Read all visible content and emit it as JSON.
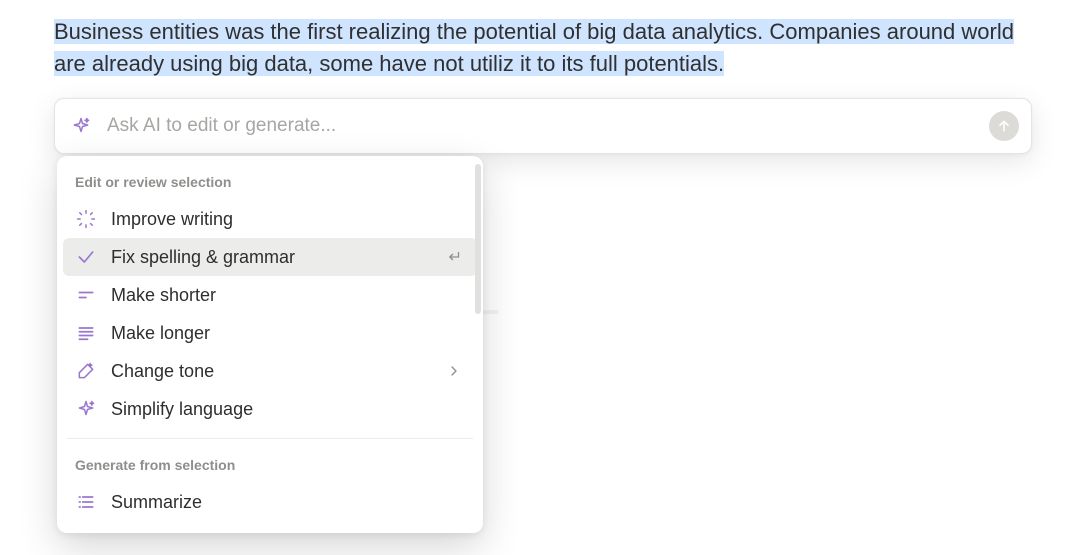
{
  "selected_text": "Business entities was the first realizing the potential of big data analytics. Companies around world are already using big data, some have not utiliz it to its full potentials.",
  "ai_bar": {
    "placeholder": "Ask AI to edit or generate..."
  },
  "menu": {
    "section_edit_label": "Edit or review selection",
    "section_generate_label": "Generate from selection",
    "items_edit": [
      {
        "icon": "improve-icon",
        "label": "Improve writing"
      },
      {
        "icon": "check-icon",
        "label": "Fix spelling & grammar",
        "hover": true,
        "trailing": "enter"
      },
      {
        "icon": "shorter-icon",
        "label": "Make shorter"
      },
      {
        "icon": "longer-icon",
        "label": "Make longer"
      },
      {
        "icon": "tone-icon",
        "label": "Change tone",
        "trailing": "submenu"
      },
      {
        "icon": "sparkle-icon",
        "label": "Simplify language"
      }
    ],
    "items_generate": [
      {
        "icon": "summarize-icon",
        "label": "Summarize"
      }
    ]
  },
  "colors": {
    "accent": "#9a77cf",
    "muted": "#8f8e8b",
    "highlight": "#cfe4ff"
  }
}
